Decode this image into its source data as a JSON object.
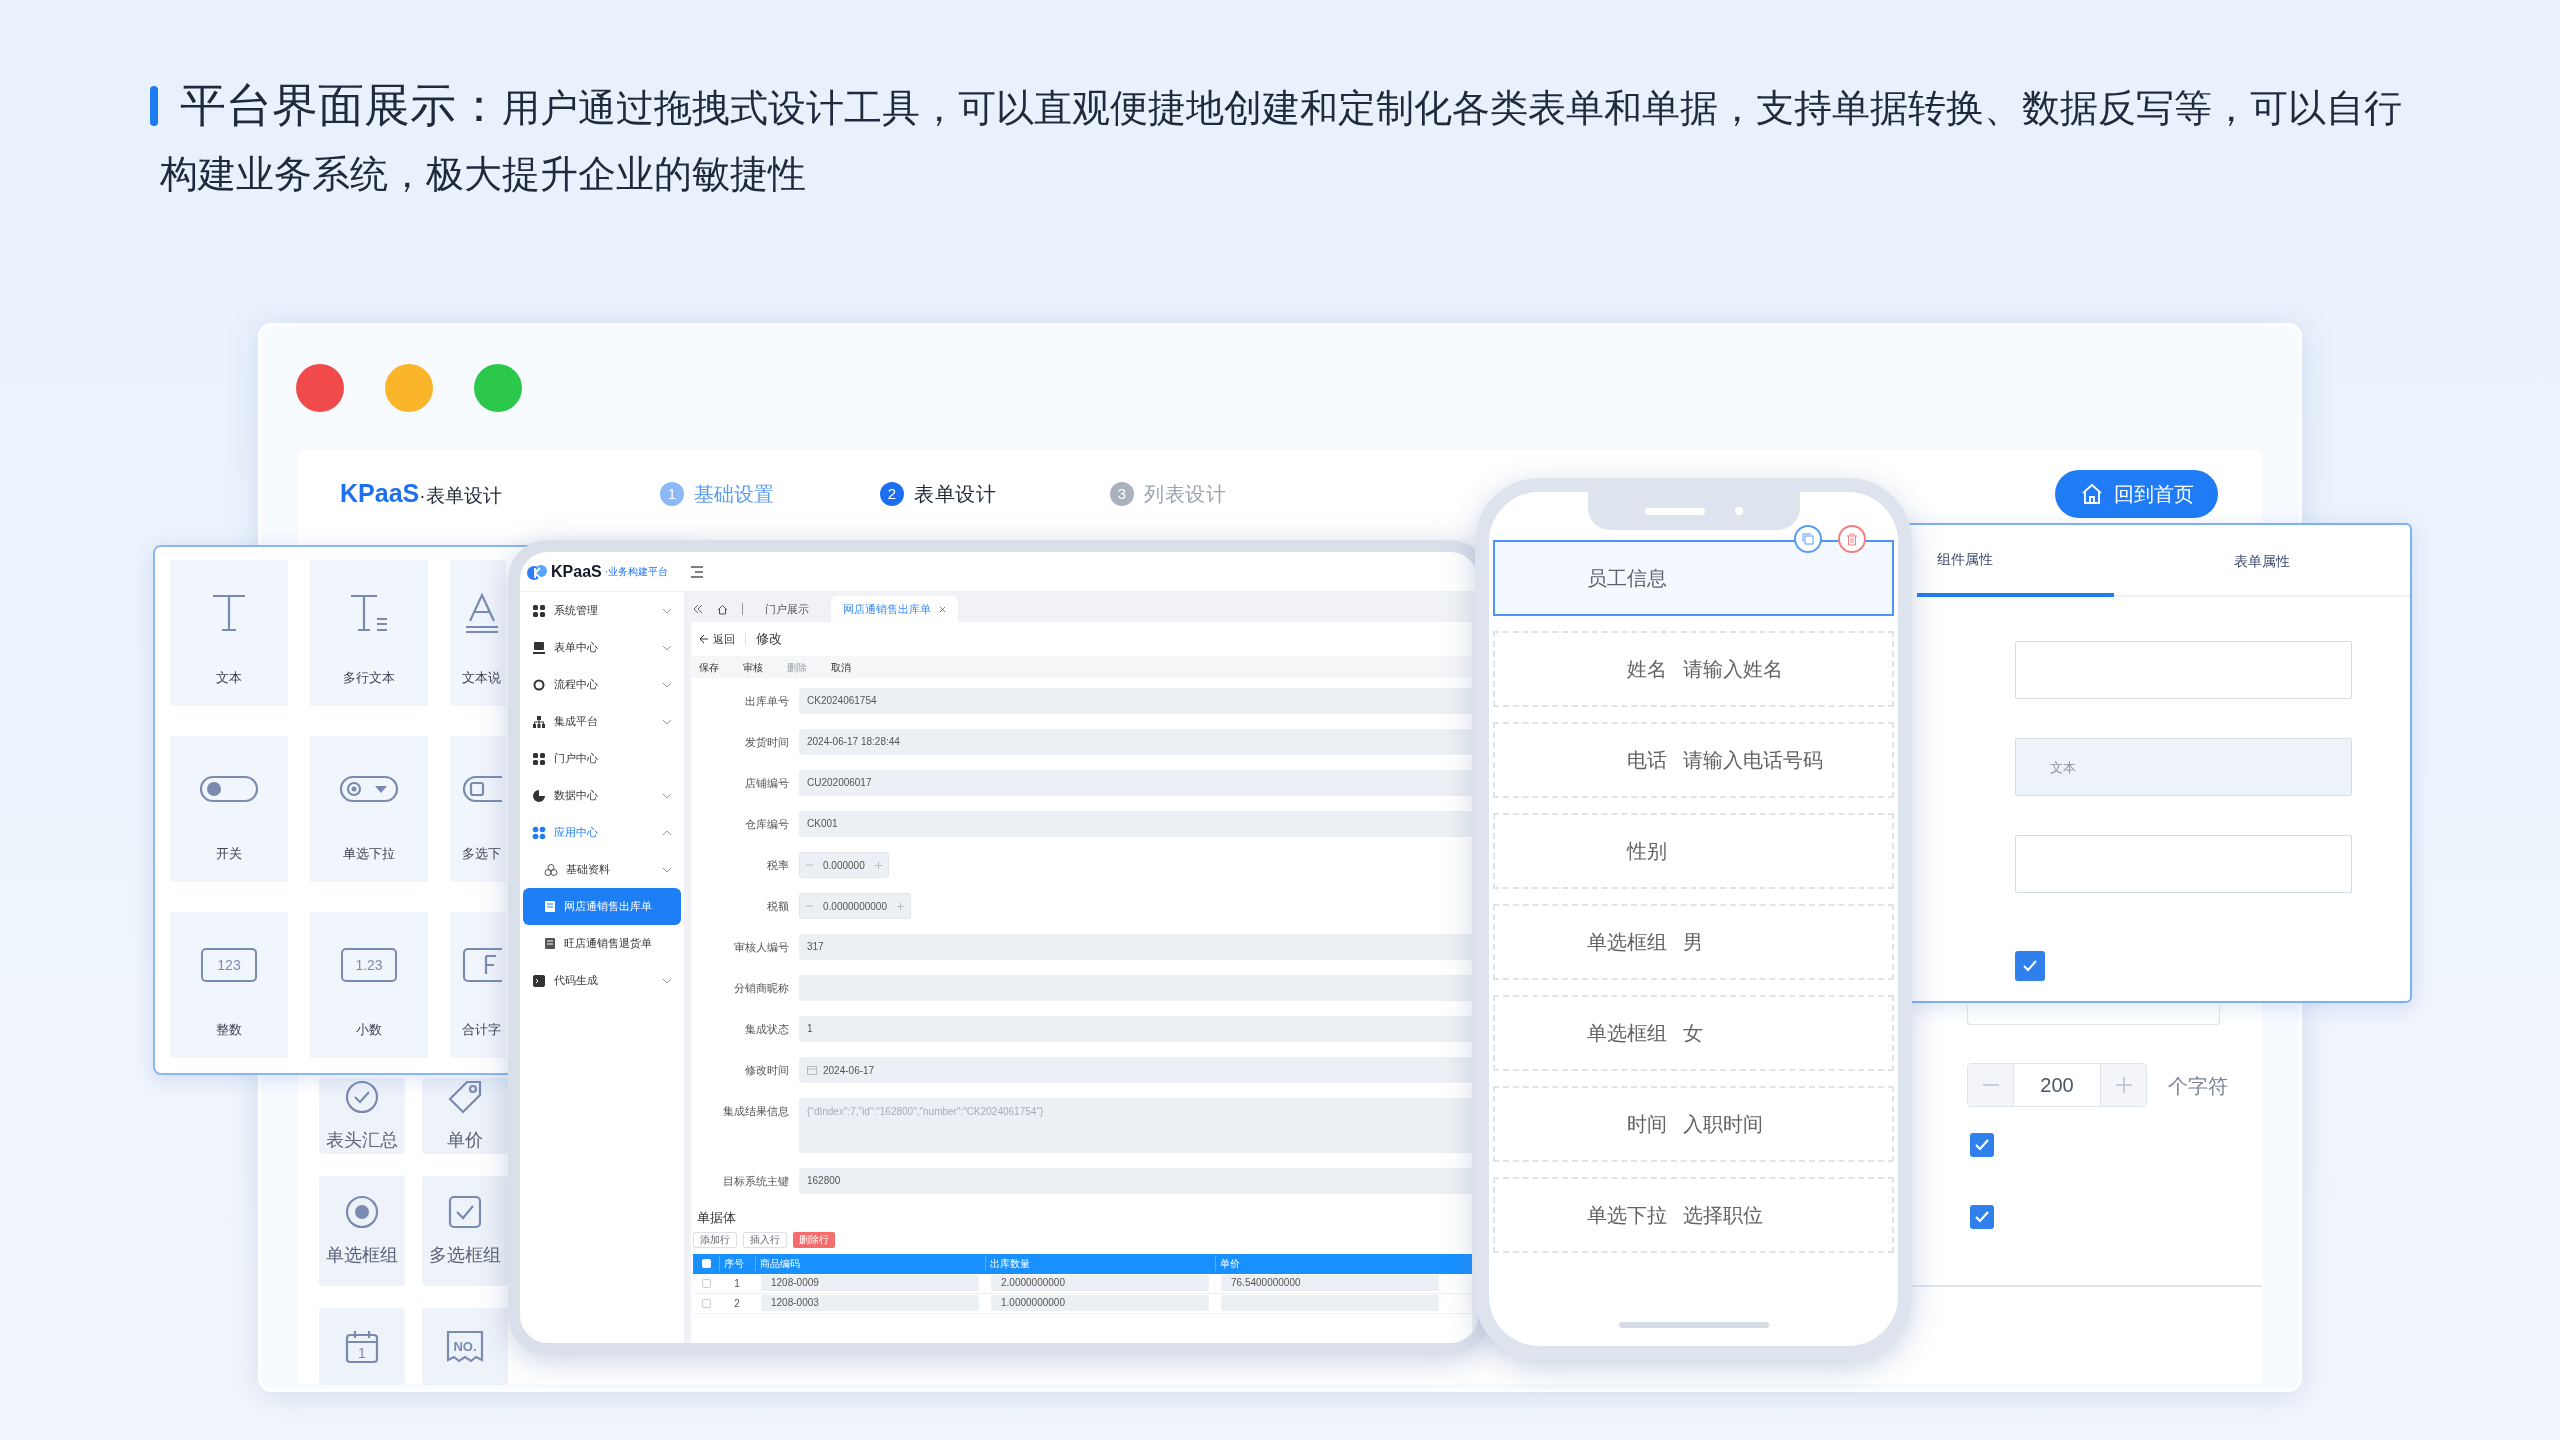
{
  "intro": {
    "title": "平台界面展示：",
    "description": "用户通过拖拽式设计工具，可以直观便捷地创建和定制化各类表单和单据，支持单据转换、数据反写等，可以自行构建业务系统，极大提升企业的敏捷性"
  },
  "window_controls": [
    {
      "color": "#f14a4a"
    },
    {
      "color": "#fbb52a"
    },
    {
      "color": "#2cc84c"
    }
  ],
  "header": {
    "brand": "KPaaS",
    "brand_suffix": "·表单设计",
    "home_button": "回到首页",
    "steps": [
      {
        "number": "1",
        "label": "基础设置",
        "done": true,
        "selected": false
      },
      {
        "number": "2",
        "label": "表单设计",
        "done": false,
        "selected": true
      },
      {
        "number": "3",
        "label": "列表设计",
        "done": false,
        "selected": false
      }
    ]
  },
  "palette": {
    "items": [
      {
        "kind": "text",
        "label": "文本"
      },
      {
        "kind": "textarea",
        "label": "多行文本"
      },
      {
        "kind": "note",
        "label": "文本说"
      },
      {
        "kind": "switch",
        "label": "开关"
      },
      {
        "kind": "select",
        "label": "单选下拉"
      },
      {
        "kind": "multiselect",
        "label": "多选下"
      },
      {
        "kind": "integer",
        "glyph": "123",
        "label": "整数"
      },
      {
        "kind": "decimal",
        "glyph": "1.23",
        "label": "小数"
      },
      {
        "kind": "sum",
        "label": "合计字"
      }
    ]
  },
  "palette_behind": {
    "items": [
      {
        "kind": "check",
        "label": "表头汇总"
      },
      {
        "kind": "tag",
        "label": "单价"
      },
      {
        "kind": "radio",
        "label": "单选框组"
      },
      {
        "kind": "checkbox",
        "label": "多选框组"
      },
      {
        "kind": "calendar",
        "glyph": "1"
      },
      {
        "kind": "serial",
        "glyph": "NO."
      }
    ]
  },
  "tablet": {
    "brand": "KPaaS",
    "brand_suffix": "·业务构建平台",
    "sidebar": [
      {
        "label": "系统管理",
        "expanded": false,
        "active": false
      },
      {
        "label": "表单中心",
        "expanded": false,
        "active": false
      },
      {
        "label": "流程中心",
        "expanded": false,
        "active": false
      },
      {
        "label": "集成平台",
        "expanded": false,
        "active": false
      },
      {
        "label": "门户中心",
        "active": false
      },
      {
        "label": "数据中心",
        "expanded": false,
        "active": false
      },
      {
        "label": "应用中心",
        "expanded": true,
        "active": true,
        "children": [
          {
            "label": "基础资料",
            "expanded": false,
            "selected": false
          },
          {
            "label": "网店通销售出库单",
            "selected": true
          },
          {
            "label": "旺店通销售退货单",
            "selected": false
          }
        ]
      },
      {
        "label": "代码生成",
        "expanded": false,
        "active": false
      }
    ],
    "tabs": [
      {
        "label": "门户展示",
        "selected": false
      },
      {
        "label": "网店通销售出库单",
        "selected": true
      }
    ],
    "back": "返回",
    "page_title": "修改",
    "toolbar": [
      {
        "label": "保存",
        "disabled": false
      },
      {
        "label": "审核",
        "disabled": false
      },
      {
        "label": "删除",
        "disabled": true
      },
      {
        "label": "取消",
        "disabled": false
      }
    ],
    "fields": [
      {
        "kind": "text",
        "label": "出库单号",
        "value": "CK2024061754"
      },
      {
        "kind": "text",
        "label": "发货时间",
        "value": "2024-06-17 18:28:44"
      },
      {
        "kind": "text",
        "label": "店铺编号",
        "value": "CU202006017"
      },
      {
        "kind": "text",
        "label": "仓库编号",
        "value": "CK001"
      },
      {
        "kind": "stepper",
        "label": "税率",
        "value": "0.000000"
      },
      {
        "kind": "stepper",
        "label": "税额",
        "value": "0.0000000000"
      },
      {
        "kind": "text",
        "label": "审核人编号",
        "value": "317"
      },
      {
        "kind": "text",
        "label": "分销商昵称"
      },
      {
        "kind": "text",
        "label": "集成状态",
        "value": "1"
      },
      {
        "kind": "date",
        "label": "修改时间",
        "value": "2024-06-17"
      },
      {
        "kind": "textarea",
        "label": "集成结果信息",
        "value": "{\"dIndex\":7,\"id\":\"162800\",\"number\":\"CK2024061754\"}"
      },
      {
        "kind": "text",
        "label": "目标系统主键",
        "value": "162800"
      }
    ],
    "body_title": "单据体",
    "body_buttons": [
      {
        "label": "添加行",
        "kind": "default"
      },
      {
        "label": "插入行",
        "kind": "default"
      },
      {
        "label": "删除行",
        "kind": "danger"
      }
    ],
    "table": {
      "select_all_checked": false,
      "columns": [
        "序号",
        "商品编码",
        "出库数量",
        "单价"
      ],
      "rows": [
        {
          "checked": false,
          "number": "1",
          "code": "1208-0009",
          "quantity": "2.0000000000",
          "price": "76.5400000000"
        },
        {
          "checked": false,
          "number": "2",
          "code": "1208-0003",
          "quantity": "1.0000000000"
        }
      ]
    }
  },
  "phone": {
    "items": [
      {
        "kind": "section",
        "label": "员工信息",
        "selected": true
      },
      {
        "kind": "field",
        "label": "姓名",
        "content": "请输入姓名",
        "selected": false
      },
      {
        "kind": "field",
        "label": "电话",
        "content": "请输入电话号码",
        "selected": false
      },
      {
        "kind": "field",
        "label": "性别",
        "selected": false
      },
      {
        "kind": "field",
        "label": "单选框组",
        "content": "男",
        "selected": false
      },
      {
        "kind": "field",
        "label": "单选框组",
        "content": "女",
        "selected": false
      },
      {
        "kind": "field",
        "label": "时间",
        "content": "入职时间",
        "selected": false
      },
      {
        "kind": "field",
        "label": "单选下拉",
        "content": "选择职位",
        "selected": false
      }
    ]
  },
  "properties": {
    "tabs": [
      {
        "label": "组件属性",
        "selected": true
      },
      {
        "label": "表单属性",
        "selected": false
      }
    ],
    "fields": [
      {
        "kind": "input",
        "disabled": false
      },
      {
        "kind": "input",
        "disabled": true,
        "placeholder": "文本"
      },
      {
        "kind": "input",
        "disabled": false
      },
      {
        "kind": "checkbox",
        "checked": true
      }
    ]
  },
  "properties_behind": {
    "stepper_value": "200",
    "unit": "个字符",
    "checkboxes": [
      {
        "checked": true
      },
      {
        "checked": true
      }
    ]
  }
}
